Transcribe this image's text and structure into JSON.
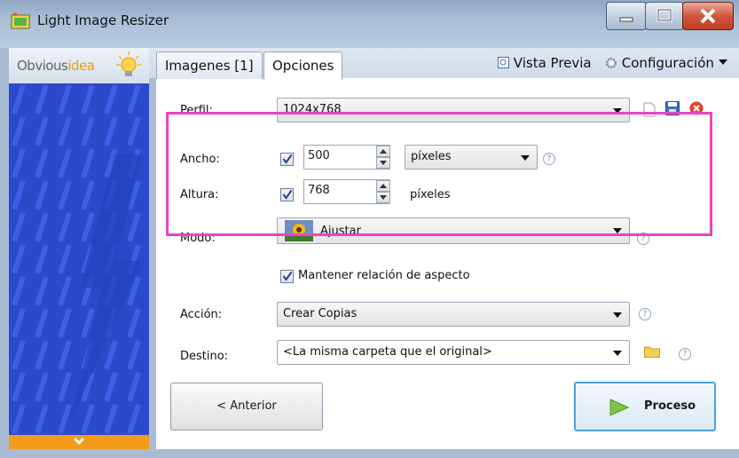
{
  "window": {
    "title": "Light Image Resizer",
    "controls": [
      "minimize-icon",
      "maximize-icon",
      "close-icon"
    ]
  },
  "sidebar": {
    "brand_part1": "Obvious",
    "brand_part2": "idea",
    "icon": "lightbulb-icon",
    "footer_icon": "chevron-down-icon"
  },
  "tabs": [
    {
      "label": "Imagenes [1]",
      "selected": false
    },
    {
      "label": "Opciones",
      "selected": true
    }
  ],
  "toolbar": {
    "preview_label": "Vista Previa",
    "preview_icon": "preview-icon",
    "config_label": "Configuración",
    "config_icon": "gear-icon"
  },
  "form": {
    "perfil_label": "Perfil:",
    "perfil_value": "1024x768",
    "perfil_icons": [
      "new-profile-icon",
      "save-icon",
      "delete-icon"
    ],
    "ancho_label": "Ancho:",
    "ancho_checked": true,
    "ancho_value": "500",
    "ancho_unit": "píxeles",
    "altura_label": "Altura:",
    "altura_checked": true,
    "altura_value": "768",
    "altura_unit": "píxeles",
    "modo_label": "Modo:",
    "modo_value": "Ajustar",
    "aspect_checked": true,
    "aspect_label": "Mantener relación de aspecto",
    "accion_label": "Acción:",
    "accion_value": "Crear Copias",
    "destino_label": "Destino:",
    "destino_value": "<La misma carpeta que el original>",
    "help_glyph": "?"
  },
  "buttons": {
    "back_label": "< Anterior",
    "process_label": "Proceso",
    "process_icon": "play-icon"
  },
  "colors": {
    "highlight": "#ea44c2",
    "sidebar": "#2e4fd2",
    "accent_orange": "#f39a1a",
    "process_border": "#4aa3df"
  }
}
